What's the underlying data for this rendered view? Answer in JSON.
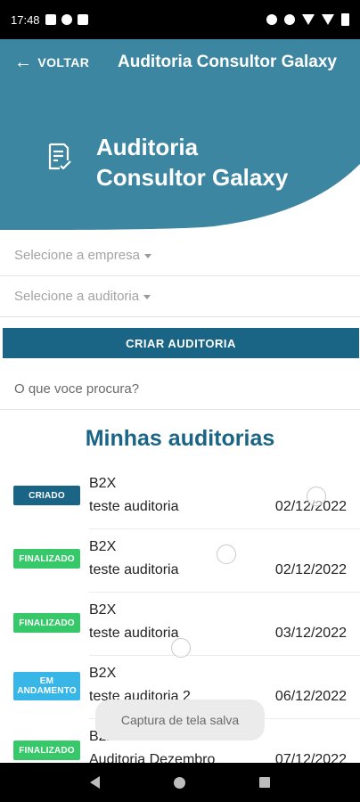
{
  "status_bar": {
    "time": "17:48",
    "left_icons": [
      "gallery-icon",
      "app-notification-icon",
      "app-notification-icon"
    ],
    "right_icons": [
      "alarm-icon",
      "mute-icon",
      "wifi-icon",
      "signal-icon",
      "battery-icon"
    ]
  },
  "app_bar": {
    "back_label": "VOLTAR",
    "title": "Auditoria Consultor Galaxy",
    "color": "#3d86a1"
  },
  "hero": {
    "title_line1": "Auditoria",
    "title_line2": "Consultor Galaxy",
    "icon": "checklist-document-icon"
  },
  "form": {
    "company_select": "Selecione a empresa",
    "audit_select": "Selecione a auditoria",
    "create_button": "CRIAR AUDITORIA",
    "search_placeholder": "O que voce procura?"
  },
  "list": {
    "title": "Minhas auditorias",
    "items": [
      {
        "status": "CRIADO",
        "company": "B2X",
        "name": "teste auditoria",
        "date": "02/12/2022"
      },
      {
        "status": "FINALIZADO",
        "company": "B2X",
        "name": "teste auditoria",
        "date": "02/12/2022"
      },
      {
        "status": "FINALIZADO",
        "company": "B2X",
        "name": "teste auditoria",
        "date": "03/12/2022"
      },
      {
        "status": "EM ANDAMENTO",
        "company": "B2X",
        "name": "teste auditoria 2",
        "date": "06/12/2022"
      },
      {
        "status": "FINALIZADO",
        "company": "B2X",
        "name": "Auditoria Dezembro",
        "date": "07/12/2022"
      }
    ]
  },
  "status_colors": {
    "criado": "#1a6585",
    "finalizado": "#37c86a",
    "em_andamento": "#39b6e8"
  },
  "toast": "Captura de tela salva"
}
